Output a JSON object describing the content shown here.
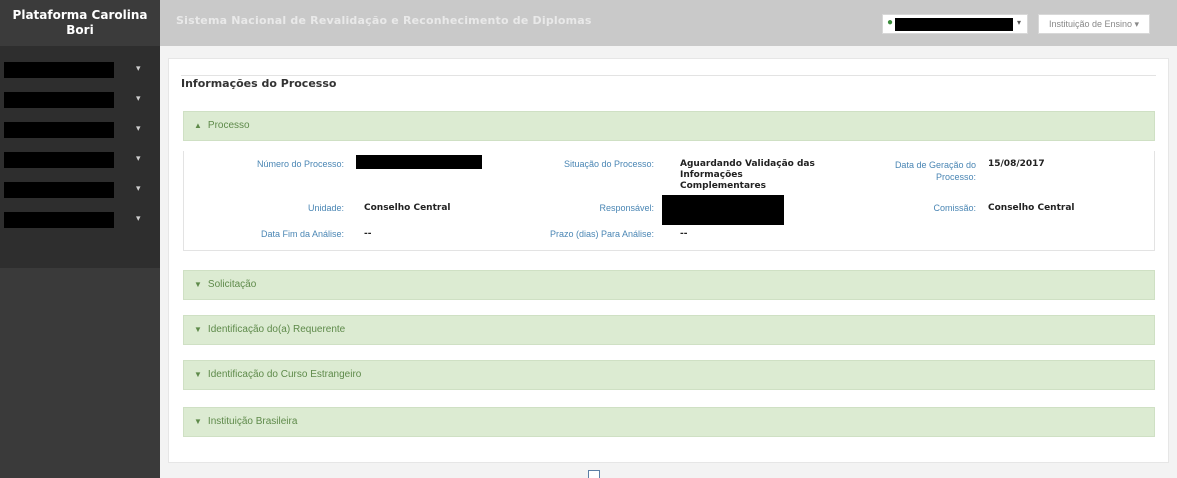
{
  "sidebar": {
    "brand": "Plataforma Carolina Bori",
    "items": [
      {
        "label": ""
      },
      {
        "label": ""
      },
      {
        "label": ""
      },
      {
        "label": ""
      },
      {
        "label": ""
      },
      {
        "label": ""
      }
    ]
  },
  "header": {
    "title": "Sistema Nacional de Revalidação e Reconhecimento de Diplomas",
    "institution_menu": "Instituição de Ensino ▾"
  },
  "section": {
    "legend": "Informações do Processo"
  },
  "panels": {
    "processo": "Processo",
    "solicitacao": "Solicitação",
    "requerente": "Identificação do(a) Requerente",
    "curso": "Identificação do Curso Estrangeiro",
    "instituicao": "Instituição Brasileira"
  },
  "process": {
    "numero_label": "Número do Processo:",
    "situacao_label": "Situação do Processo:",
    "situacao_value": "Aguardando Validação das Informações Complementares",
    "data_geracao_label": "Data de Geração do Processo:",
    "data_geracao_value": "15/08/2017",
    "unidade_label": "Unidade:",
    "unidade_value": "Conselho Central",
    "responsavel_label": "Responsável:",
    "comissao_label": "Comissão:",
    "comissao_value": "Conselho Central",
    "data_fim_label": "Data Fim da Análise:",
    "data_fim_value": "--",
    "prazo_label": "Prazo (dias) Para Análise:",
    "prazo_value": "--"
  },
  "colors": {
    "accent_green": "#dcebd2",
    "label_blue": "#4a86b4",
    "sidebar": "#2e2e2e"
  }
}
